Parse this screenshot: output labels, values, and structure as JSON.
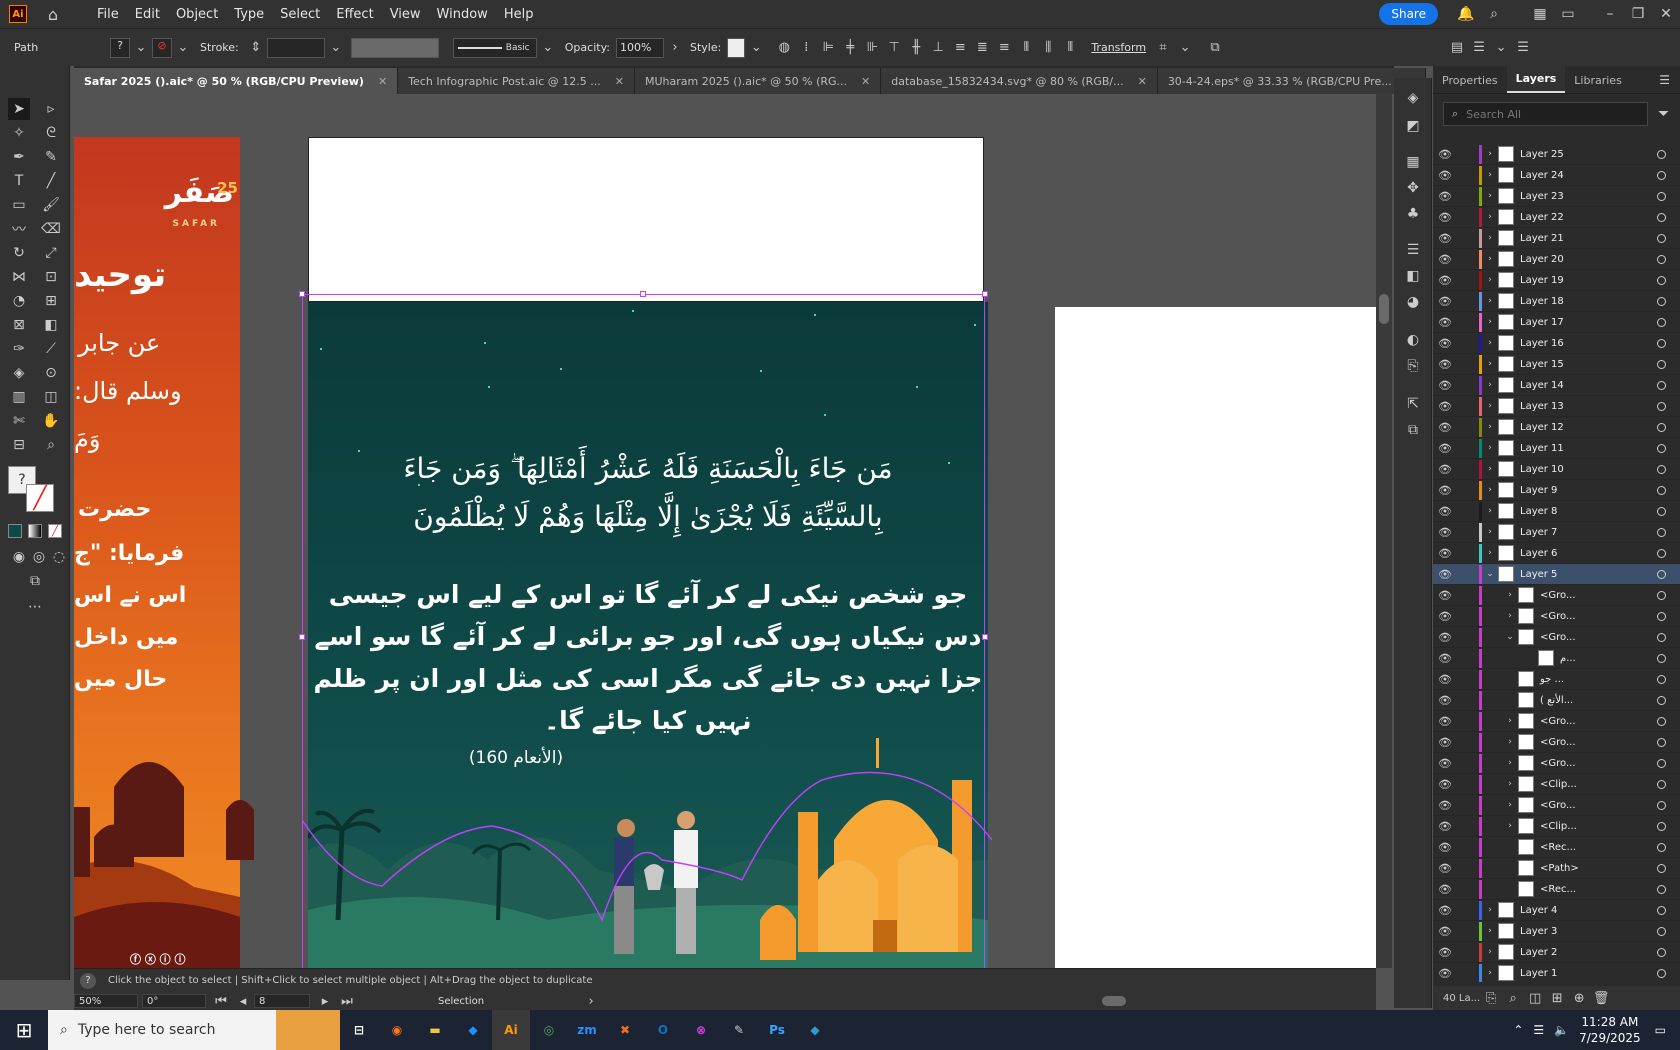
{
  "menubar": {
    "app_logo": "Ai",
    "menus": [
      "File",
      "Edit",
      "Object",
      "Type",
      "Select",
      "Effect",
      "View",
      "Window",
      "Help"
    ],
    "share_label": "Share"
  },
  "control": {
    "selection_type": "Path",
    "stroke_label": "Stroke:",
    "brush_label": "Basic",
    "opacity_label": "Opacity:",
    "opacity_value": "100%",
    "style_label": "Style:",
    "transform_label": "Transform"
  },
  "tabs": [
    {
      "label": "Safar 2025 ().aic* @ 50 % (RGB/CPU Preview)",
      "active": true
    },
    {
      "label": "Tech Infographic Post.aic @ 12.5 ...",
      "active": false
    },
    {
      "label": "MUharam 2025 ().aic* @ 50 % (RG...",
      "active": false
    },
    {
      "label": "database_15832434.svg* @ 80 % (RGB/...",
      "active": false
    },
    {
      "label": "30-4-24.eps* @ 33.33 % (RGB/CPU Pre...",
      "active": false
    }
  ],
  "artwork": {
    "left_logo": "صَفَر",
    "left_logo_year": "25",
    "left_logo_sub": "SAFAR",
    "left_heading": "توحید",
    "left_lines": [
      "عن جابر",
      "وسلم قال:",
      "وَمَ",
      "حضرت",
      "فرمایا: \"ج",
      "اس نے اس",
      "میں داخل",
      "حال میں"
    ],
    "verse_line1": "مَن جَاءَ بِالْحَسَنَةِ فَلَهُ عَشْرُ أَمْثَالِهَا ۖ وَمَن جَاءَ",
    "verse_line2": "بِالسَّيِّئَةِ فَلَا يُجْزَىٰ إِلَّا مِثْلَهَا وَهُمْ لَا يُظْلَمُونَ",
    "urdu_lines": [
      "جو شخص نیکی لے کر آئے گا تو اس کے لیے اس جیسی",
      "دس نیکیاں ہوں گی، اور جو برائی لے کر آئے گا سو اسے",
      "جزا نہیں دی جائے گی مگر اسی کی مثل اور ان پر ظلم",
      "نہیں کیا جائے گا۔"
    ],
    "reference": "(الأنعام 160)"
  },
  "status": {
    "hint": "Click the object to select  |  Shift+Click to select multiple object  |  Alt+Drag the object to duplicate",
    "zoom": "50%",
    "rotation": "0°",
    "artboard_num": "8",
    "tool_name": "Selection"
  },
  "panel": {
    "tabs": [
      "Properties",
      "Layers",
      "Libraries"
    ],
    "search_placeholder": "Search All",
    "layers": [
      {
        "name": "Layer 25",
        "color": "#a03cc8",
        "level": 0
      },
      {
        "name": "Layer 24",
        "color": "#c89a00",
        "level": 0
      },
      {
        "name": "Layer 23",
        "color": "#7bb000",
        "level": 0
      },
      {
        "name": "Layer 22",
        "color": "#b01a3c",
        "level": 0
      },
      {
        "name": "Layer 21",
        "color": "#c89a9a",
        "level": 0
      },
      {
        "name": "Layer 20",
        "color": "#f08c64",
        "level": 0
      },
      {
        "name": "Layer 19",
        "color": "#a01414",
        "level": 0
      },
      {
        "name": "Layer 18",
        "color": "#6496e6",
        "level": 0
      },
      {
        "name": "Layer 17",
        "color": "#e664c8",
        "level": 0
      },
      {
        "name": "Layer 16",
        "color": "#1a1a9a",
        "level": 0
      },
      {
        "name": "Layer 15",
        "color": "#e6a000",
        "level": 0
      },
      {
        "name": "Layer 14",
        "color": "#8a3cc8",
        "level": 0
      },
      {
        "name": "Layer 13",
        "color": "#e66478",
        "level": 0
      },
      {
        "name": "Layer 12",
        "color": "#8a8a00",
        "level": 0
      },
      {
        "name": "Layer 11",
        "color": "#008a6e",
        "level": 0
      },
      {
        "name": "Layer 10",
        "color": "#b0143c",
        "level": 0
      },
      {
        "name": "Layer 9",
        "color": "#e68a1a",
        "level": 0
      },
      {
        "name": "Layer 8",
        "color": "#1a1a1a",
        "level": 0
      },
      {
        "name": "Layer 7",
        "color": "#c8c8c8",
        "level": 0
      },
      {
        "name": "Layer 6",
        "color": "#3cc8c8",
        "level": 0
      },
      {
        "name": "Layer 5",
        "color": "#c83cc8",
        "level": 0,
        "selected": true,
        "expanded": true
      },
      {
        "name": "<Gro...",
        "color": "#c83cc8",
        "level": 1,
        "arrow": "right"
      },
      {
        "name": "<Gro...",
        "color": "#c83cc8",
        "level": 1,
        "arrow": "right"
      },
      {
        "name": "<Gro...",
        "color": "#c83cc8",
        "level": 1,
        "arrow": "down"
      },
      {
        "name": "م...",
        "color": "#c83cc8",
        "level": 2
      },
      {
        "name": "جو ...",
        "color": "#c83cc8",
        "level": 1
      },
      {
        "name": "( الأنع...",
        "color": "#c83cc8",
        "level": 1
      },
      {
        "name": "<Gro...",
        "color": "#c83cc8",
        "level": 1,
        "arrow": "right"
      },
      {
        "name": "<Gro...",
        "color": "#c83cc8",
        "level": 1,
        "arrow": "right"
      },
      {
        "name": "<Gro...",
        "color": "#c83cc8",
        "level": 1,
        "arrow": "right"
      },
      {
        "name": "<Clip...",
        "color": "#c83cc8",
        "level": 1,
        "arrow": "right"
      },
      {
        "name": "<Gro...",
        "color": "#c83cc8",
        "level": 1,
        "arrow": "right"
      },
      {
        "name": "<Clip...",
        "color": "#c83cc8",
        "level": 1,
        "arrow": "right"
      },
      {
        "name": "<Rec...",
        "color": "#c83cc8",
        "level": 1
      },
      {
        "name": "<Path>",
        "color": "#c83cc8",
        "level": 1
      },
      {
        "name": "<Rec...",
        "color": "#c83cc8",
        "level": 1
      },
      {
        "name": "Layer 4",
        "color": "#3c64e6",
        "level": 0
      },
      {
        "name": "Layer 3",
        "color": "#64c83c",
        "level": 0
      },
      {
        "name": "Layer 2",
        "color": "#c83c3c",
        "level": 0
      },
      {
        "name": "Layer 1",
        "color": "#3c8ae6",
        "level": 0
      }
    ],
    "footer_count": "40 La..."
  },
  "taskbar": {
    "search_placeholder": "Type here to search",
    "time": "11:28 AM",
    "date": "7/29/2025"
  }
}
